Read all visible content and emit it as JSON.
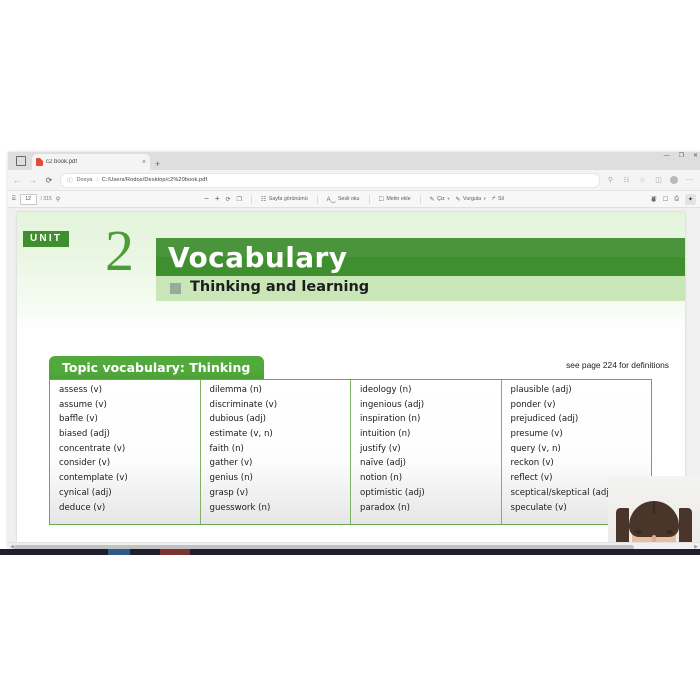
{
  "browser": {
    "tab": {
      "title": "c2 book.pdf",
      "close_label": "×",
      "file_icon": "pdf-file-icon"
    },
    "new_tab_label": "+",
    "window_controls": {
      "minimize": "—",
      "maximize": "❐",
      "close": "✕"
    },
    "nav": {
      "back": "←",
      "forward": "→",
      "reload": "⟳"
    },
    "omnibox": {
      "info_icon": "ⓘ",
      "scheme_label": "Dosya",
      "separator": "|",
      "url": "C:/Users/Rodos/Desktop/c2%20book.pdf"
    },
    "toolbar_icons": [
      "search-icon",
      "collections-icon",
      "favorite-icon",
      "split-screen-icon",
      "profile-avatar",
      "more-options-icon"
    ]
  },
  "pdf_toolbar": {
    "thumbnails_label": "⌸",
    "page_number": "12",
    "page_total": "/ 315",
    "find_label": "⚲",
    "zoom_out": "−",
    "zoom_in": "+",
    "rotate": "⟳",
    "fit_page": "❐",
    "page_view_label": "Sayfa görünümü",
    "read_aloud_label": "Sesli oku",
    "add_text_label": "Metin ekle",
    "draw_label": "Çiz",
    "highlight_label": "Vurgula",
    "erase_label": "Sil",
    "caret": "▾",
    "right_icons": [
      "comment-icon",
      "save-icon",
      "print-icon",
      "select-tool-icon"
    ]
  },
  "pdf_page": {
    "unit_badge": "UNIT",
    "unit_number": "2",
    "title": "Vocabulary",
    "subtitle": "Thinking and learning",
    "topic_header": "Topic vocabulary: Thinking",
    "see_page_note": "see page 224 for definitions",
    "columns": [
      [
        "assess (v)",
        "assume (v)",
        "baffle (v)",
        "biased (adj)",
        "concentrate (v)",
        "consider (v)",
        "contemplate (v)",
        "cynical (adj)",
        "deduce (v)"
      ],
      [
        "dilemma (n)",
        "discriminate (v)",
        "dubious (adj)",
        "estimate (v, n)",
        "faith (n)",
        "gather (v)",
        "genius (n)",
        "grasp (v)",
        "guesswork (n)"
      ],
      [
        "ideology (n)",
        "ingenious (adj)",
        "inspiration (n)",
        "intuition (n)",
        "justify (v)",
        "naïve (adj)",
        "notion (n)",
        "optimistic (adj)",
        "paradox (n)"
      ],
      [
        "plausible (adj)",
        "ponder (v)",
        "prejudiced (adj)",
        "presume (v)",
        "query (v, n)",
        "reckon (v)",
        "reflect (v)",
        "sceptical/skeptical (adj)",
        "speculate (v)"
      ]
    ]
  },
  "webcam": {
    "label": "presenter-video-overlay"
  },
  "colors": {
    "dark_green": "#3f8f2f",
    "mid_green": "#52a93c",
    "light_green_band": "#c8e6b7",
    "page_tint": "#e4f4dc",
    "unit_number_green": "#4f9c37",
    "table_border": "#6aa94f",
    "shirt_yellow": "#d9a72a"
  }
}
